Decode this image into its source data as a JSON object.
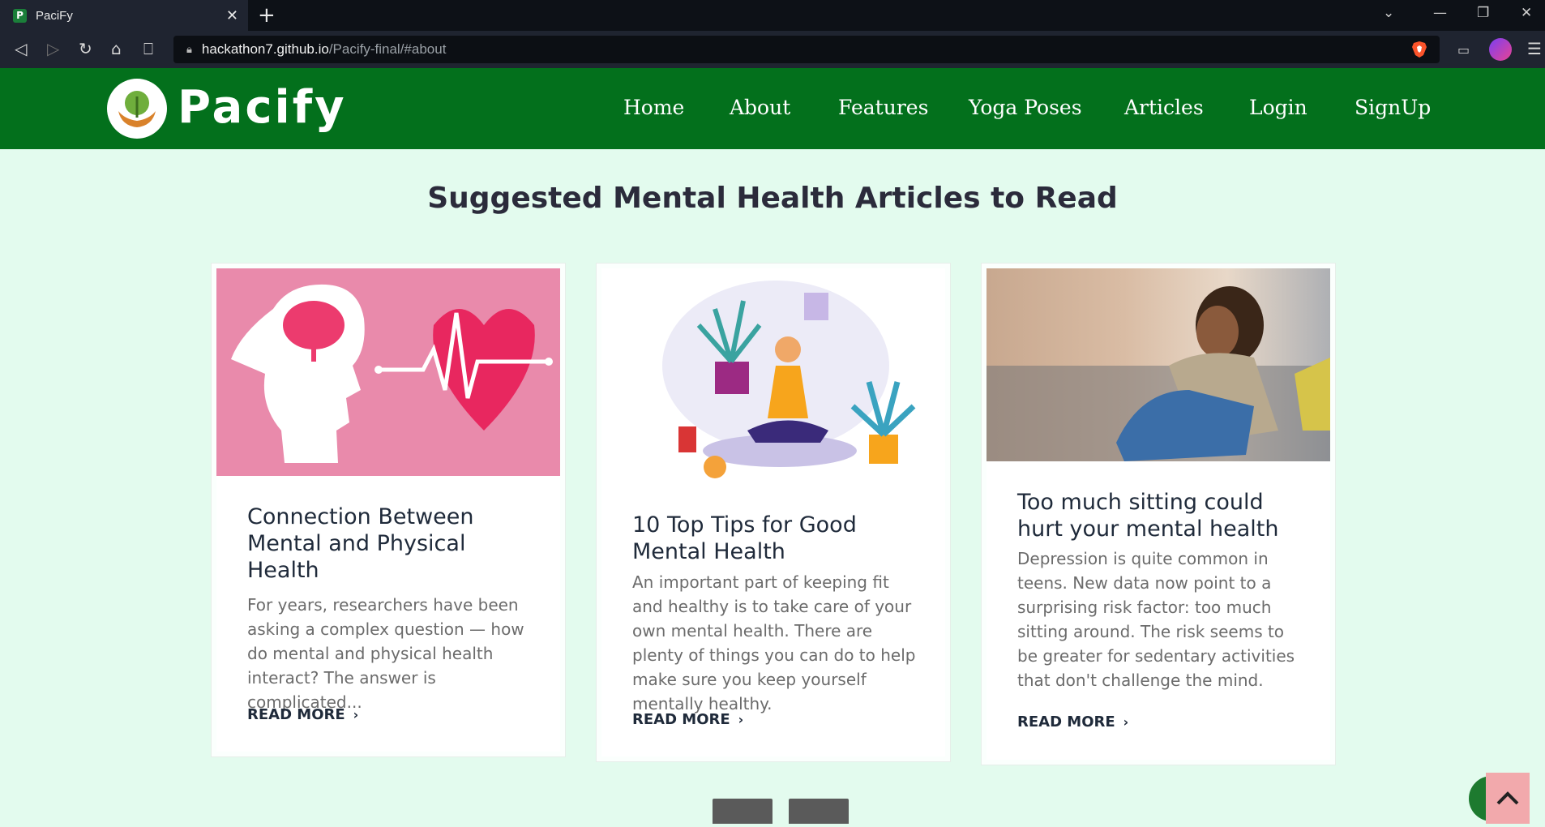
{
  "browser": {
    "tab_title": "PaciFy",
    "favicon_letter": "P",
    "url_host": "hackathon7.github.io",
    "url_path": "/Pacify-final/#about"
  },
  "site": {
    "logo_text": "Pacify",
    "nav": [
      "Home",
      "About",
      "Features",
      "Yoga Poses",
      "Articles",
      "Login",
      "SignUp"
    ],
    "colors": {
      "header": "#03701c",
      "background": "#e3fbee"
    }
  },
  "main": {
    "heading": "Suggested Mental Health Articles to Read",
    "read_more_label": "READ MORE",
    "articles": [
      {
        "title": "Connection Between Mental and Physical Health",
        "text": "For years, researchers have been asking a complex question — how do mental and physical health interact? The answer is complicated..."
      },
      {
        "title": "10 Top Tips for Good Mental Health",
        "text": "An important part of keeping fit and healthy is to take care of your own mental health. There are plenty of things you can do to help make sure you keep yourself mentally healthy."
      },
      {
        "title": "Too much sitting could hurt your mental health",
        "text": "Depression is quite common in teens. New data now point to a surprising risk factor: too much sitting around. The risk seems to be greater for sedentary activities that don't challenge the mind."
      }
    ]
  }
}
